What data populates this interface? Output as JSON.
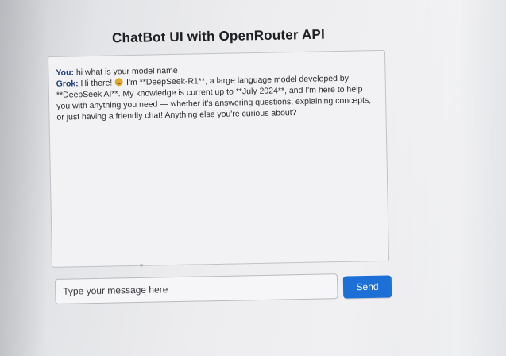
{
  "app": {
    "title": "ChatBot UI with OpenRouter API"
  },
  "chat": {
    "messages": [
      {
        "speaker": "You:",
        "text": "hi what is your model name"
      },
      {
        "speaker": "Grok:",
        "text_before_emoji": "Hi there!",
        "emoji": "smiling-face-emoji",
        "text": "I'm **DeepSeek-R1**, a large language model developed by **DeepSeek AI**. My knowledge is current up to **July 2024**, and I'm here to help you with anything you need — whether it's answering questions, explaining concepts, or just having a friendly chat! Anything else you're curious about?"
      }
    ]
  },
  "composer": {
    "placeholder": "Type your message here",
    "value": "",
    "send_label": "Send"
  },
  "colors": {
    "accent": "#1d6fd6",
    "speaker_label": "#1f3f7a",
    "title": "#1e1f23"
  }
}
